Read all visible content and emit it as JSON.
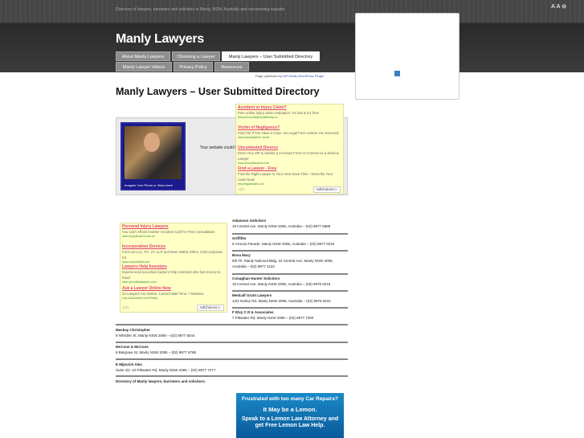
{
  "header": {
    "tagline": "Directory of lawyers, barristers and solicitors in Manly, NSW, Australia and surrounding suburbs",
    "title": "Manly Lawyers",
    "font_controls": "A A ⊖"
  },
  "nav": [
    {
      "label": "About Manly Lawyers"
    },
    {
      "label": "Choosing a Lawyer"
    },
    {
      "label": "Manly Lawyers – User Submitted Directory"
    },
    {
      "label": "Manly Lawyer Videos"
    },
    {
      "label": "Privacy Policy"
    },
    {
      "label": "Resources"
    }
  ],
  "optimized": {
    "prefix": "Page optimized by",
    "link": "WP Minify WordPress Plugin"
  },
  "page_title": "Manly Lawyers – User Submitted Directory",
  "feature": {
    "caption": "Imagine Your Photo or Video here",
    "text": "Your website could b"
  },
  "ad_top": {
    "items": [
      {
        "title": "Accident or Injury Claim?",
        "desc": "Free online injury claim evaluation. It's fast & It's free!",
        "url": "www.personalinjuryclaimhelp.co"
      },
      {
        "title": "Victim of Negligence?",
        "desc": "Find Out If You Have a Case. No Legal Fees Unless You Succeed.",
        "url": "www.injuryhelpline.net.au"
      },
      {
        "title": "Uncontested Divorce",
        "desc": "Enter Your ZIP & Submit a 2-minute Form to Connect w/ a Divorce Lawyer",
        "url": "www.divorcelawyers.com"
      },
      {
        "title": "Find a Lawyer - Free",
        "desc": "Find the Right Lawyer in Your Area Save Time - Describe Your Case Now!",
        "url": "www.legalmatch.com"
      }
    ],
    "adchoices": "AdChoices ▷"
  },
  "ad_left": {
    "items": [
      {
        "title": "Personal Injury Lawyers",
        "desc": "You Can't Afford Another Accident Call For Free Consultation",
        "url": "www.injurylawyers.com.au"
      },
      {
        "title": "Incorporation Services",
        "desc": "Form an LLC, PC, LP, LLP and More Within 48hrs. Call Corporate Kit",
        "url": "www.corporatekit.com"
      },
      {
        "title": "Lawyers Help Investors",
        "desc": "Experienced securities lawyers help investors who lost money to fraud",
        "url": "www.securitieslawyers.com"
      },
      {
        "title": "Ask a Lawyer Online Now",
        "desc": "24 Lawyers Are Online. Current Wait Time: 7 Minutes.",
        "url": "Law.JustAnswer.com/Family"
      }
    ],
    "adchoices": "AdChoices ▷"
  },
  "listings_right": [
    {
      "name": "Adamson Solicitors",
      "address": "19 Central Ave, Manly NSW 2095, Australia – (02) 9977 5888"
    },
    {
      "name": "Griffiths",
      "address": "5 Victoria Parade, Manly NSW 2095, Australia – (02) 9977 0233"
    },
    {
      "name": "Bova Mary",
      "address": "5th Flr, Manly National Bldg, 22 Central Ave, Manly NSW 2095, Australia – (02) 9977 1133"
    },
    {
      "name": "Conaghan Hunter Solicitors",
      "address": "19 Central Ave, Manly NSW 2095, Australia – (02) 9976 0215"
    },
    {
      "name": "Medcalf Grant Lawyers",
      "address": "1/22 Darley Rd, Manly NSW 2095, Australia – (02) 9976 0231"
    },
    {
      "name": "F Elvy C R & Associates",
      "address": "7 Pittwater Rd, Manly NSW 2095 – (02) 9977 7300"
    }
  ],
  "listings_full": [
    {
      "name": "Mackay Christopher",
      "address": "9 Whistler St, Manly NSW 2095 – (02) 9977 8044"
    },
    {
      "name": "McCone & McCone",
      "address": "8 Belgrave St, Manly NSW 2095 – (02) 9977 6788"
    },
    {
      "name": "E Mijovich Alex",
      "address": "Suite 4/2 -10 Pittwater Rd, Manly NSW 2095 – (02) 9977 7277"
    }
  ],
  "directory_footer": "Directory of Manly lawyers, barristers and solicitors.",
  "bottom_ad": {
    "line1": "Frustrated with too many Car Repairs?",
    "line2": "It May be a Lemon.",
    "line3": "Speak to a Lemon Law Attorney and",
    "line4": "get Free Lemon Law Help."
  }
}
